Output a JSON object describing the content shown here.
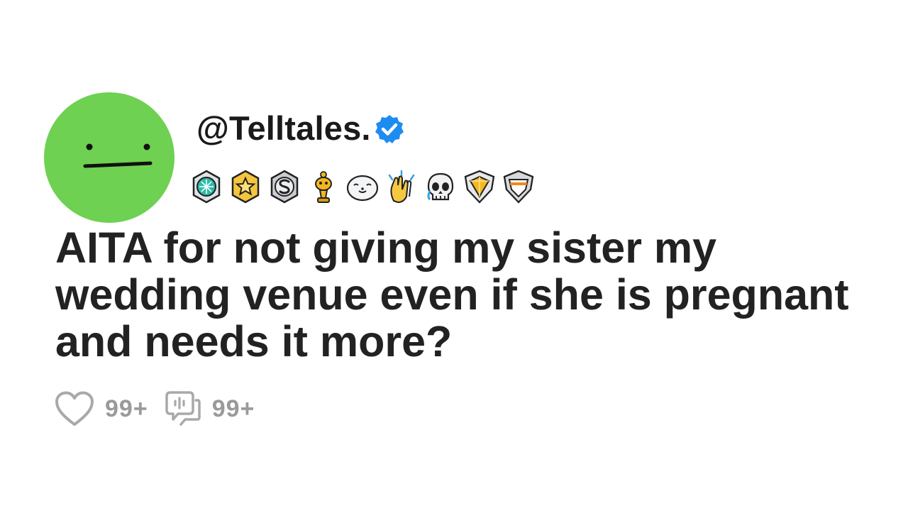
{
  "post": {
    "username": "@Telltales.",
    "verified": true,
    "title": "AITA for not giving my sister my wedding venue even if she is pregnant and needs it more?",
    "avatar_color": "#6ed151",
    "verified_color": "#1d8cf0",
    "badges": [
      "diamond-medal-icon",
      "star-medal-icon",
      "silver-s-medal-icon",
      "golden-trophy-icon",
      "smiling-seal-icon",
      "clapping-hands-icon",
      "crying-skull-icon",
      "gold-gem-shield-icon",
      "silver-shield-icon"
    ],
    "stats": {
      "likes": "99+",
      "comments": "99+"
    }
  }
}
